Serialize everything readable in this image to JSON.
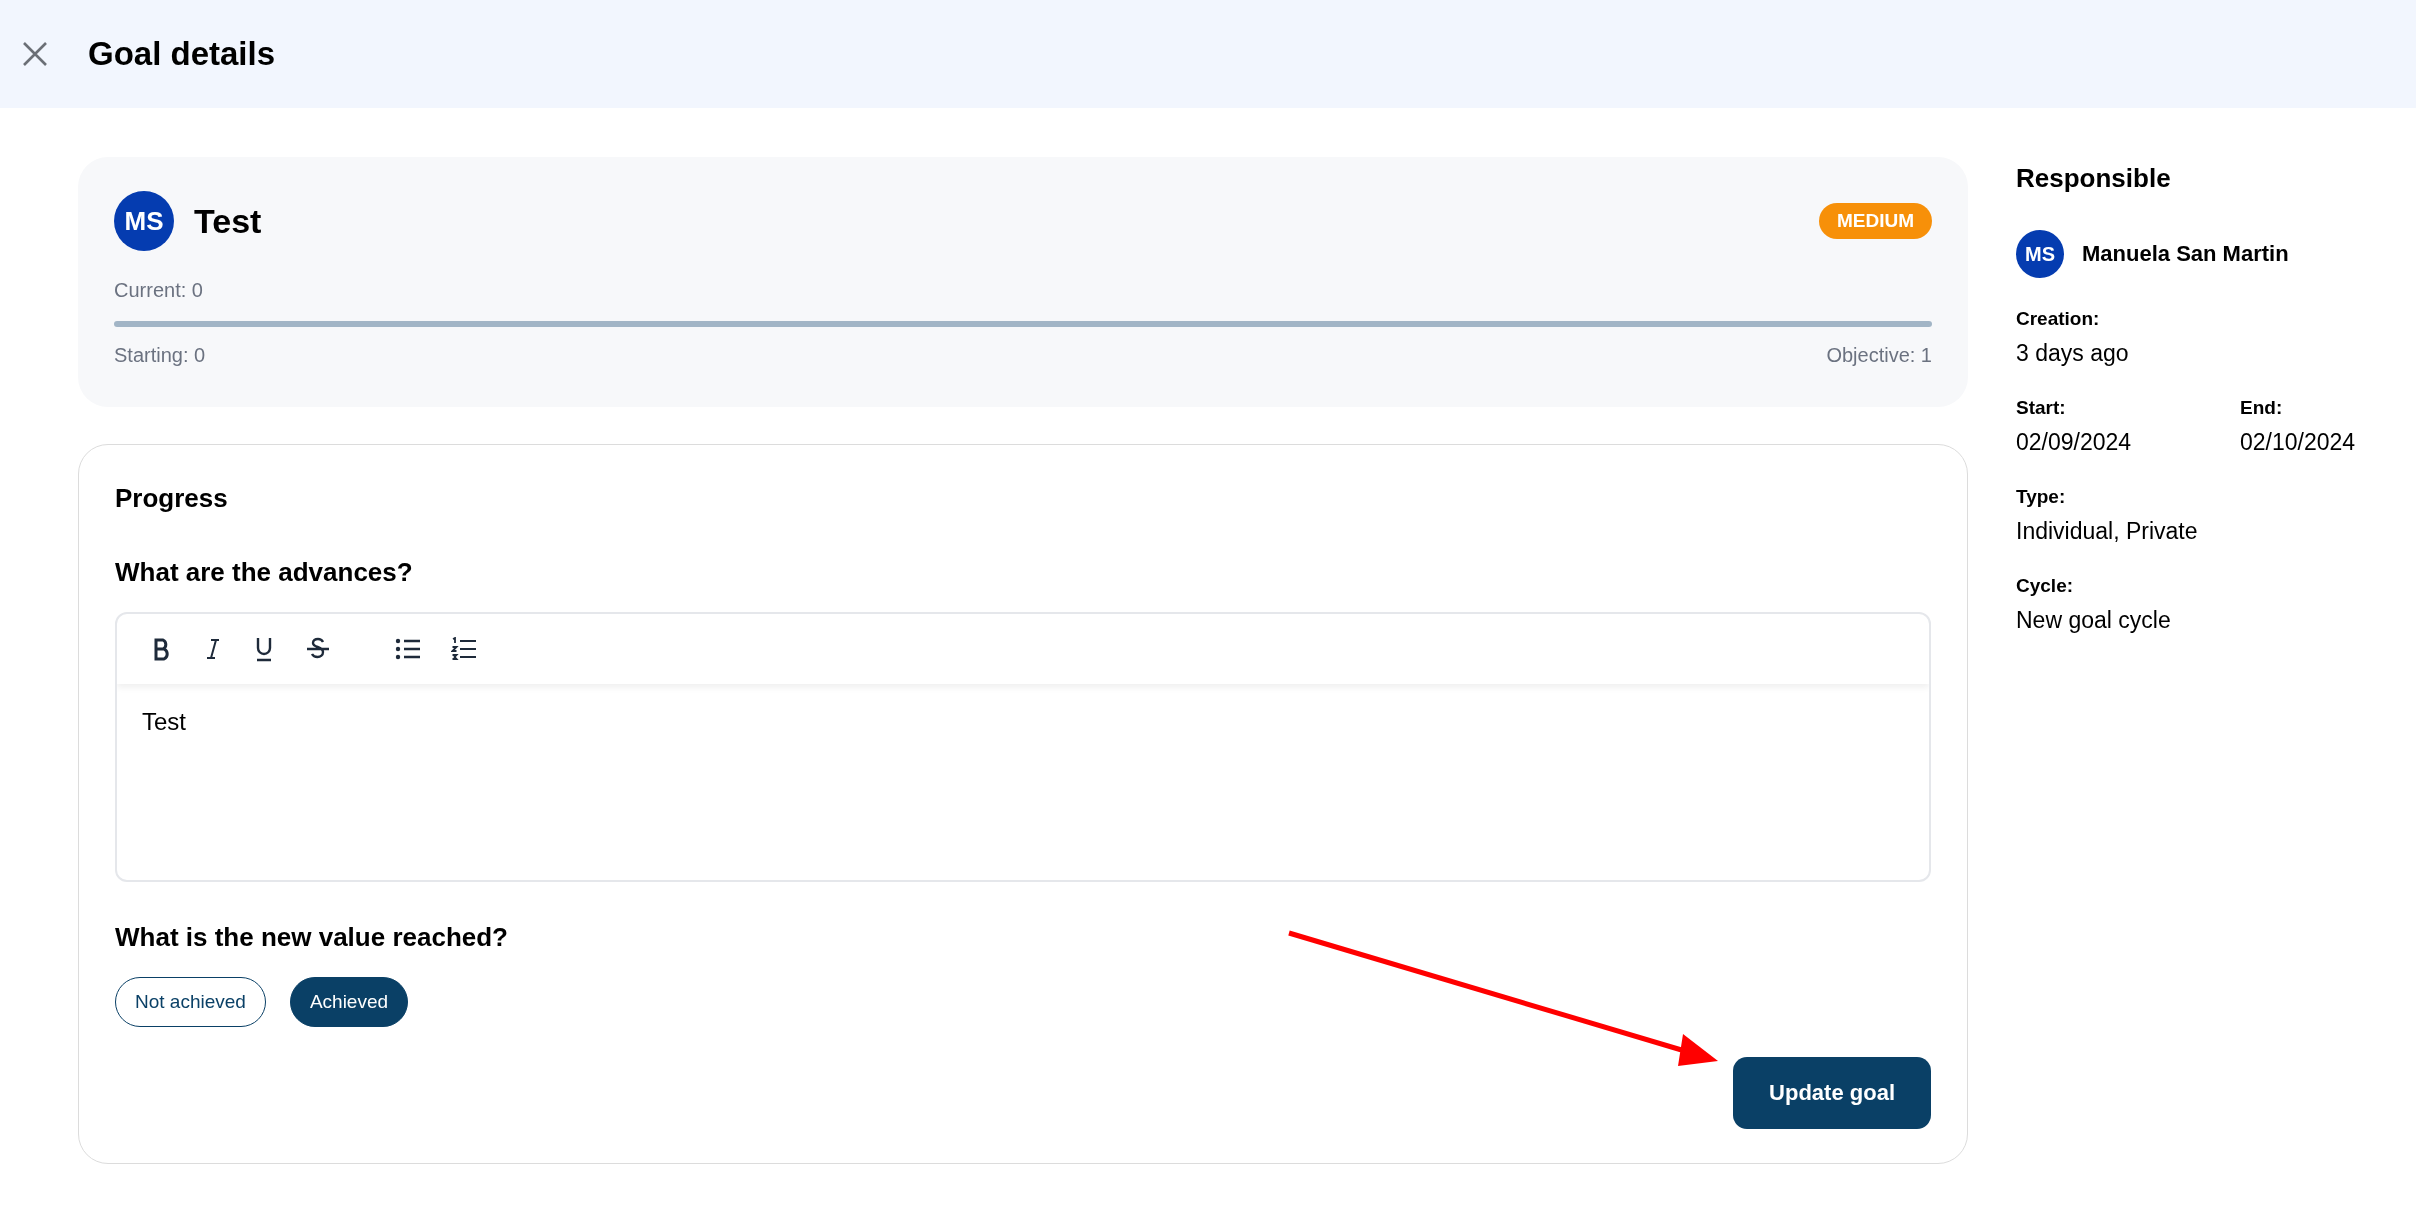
{
  "header": {
    "title": "Goal details"
  },
  "goal": {
    "initials": "MS",
    "title": "Test",
    "priority": "MEDIUM",
    "current": "Current: 0",
    "level": 0,
    "starting": "Starting: 0",
    "objective": "Objective: 1"
  },
  "progress": {
    "title": "Progress",
    "question": "What are the advances?",
    "toolbar": [
      {
        "kind": "bold"
      },
      {
        "kind": "italic"
      },
      {
        "kind": "underline"
      },
      {
        "kind": "strike"
      },
      {
        "kind": "bullets"
      },
      {
        "kind": "numbers"
      }
    ],
    "text": "Test",
    "value_question": "What is the new value reached?",
    "options": [
      {
        "label": "Not achieved",
        "selected": false
      },
      {
        "label": "Achieved",
        "selected": true
      }
    ],
    "submit": "Update goal"
  },
  "sidebar": {
    "title": "Responsible",
    "initials": "MS",
    "name": "Manuela San Martin",
    "fields": [
      {
        "label": "Creation:",
        "value": "3 days ago"
      },
      {
        "label": "Start:",
        "value": "02/09/2024",
        "label2": "End:",
        "value2": "02/10/2024"
      },
      {
        "label": "Type:",
        "value": "Individual, Private"
      },
      {
        "label": "Cycle:",
        "value": "New goal cycle"
      }
    ]
  }
}
